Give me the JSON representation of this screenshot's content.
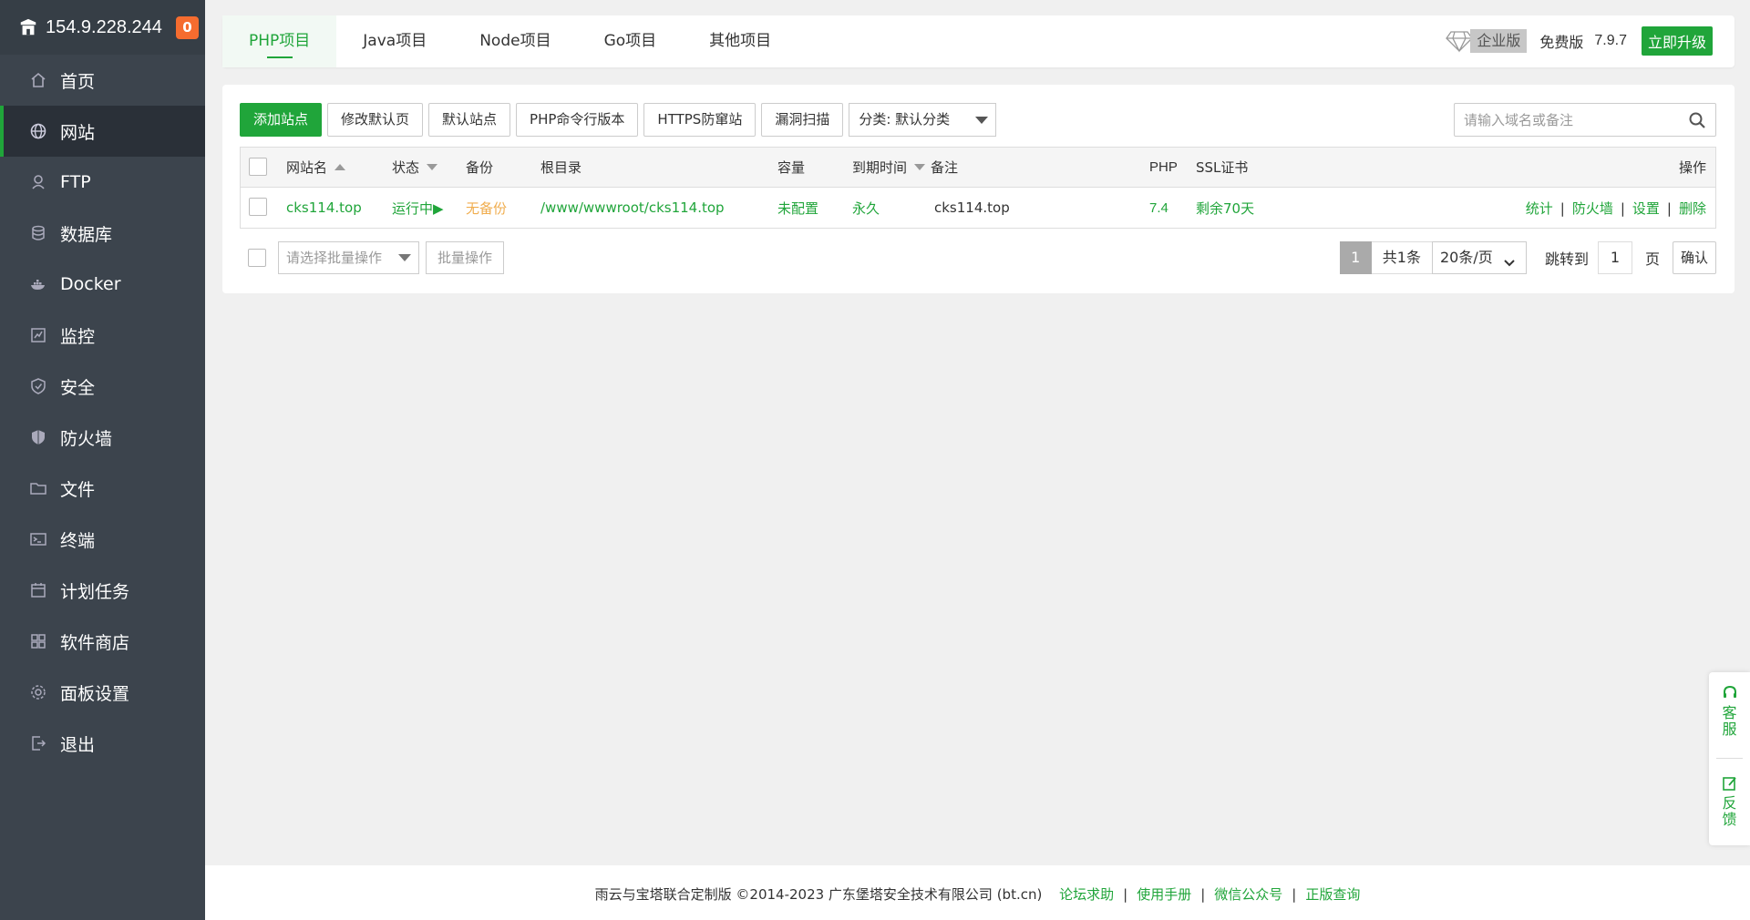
{
  "sidebar": {
    "ip": "154.9.228.244",
    "badge": "0",
    "items": [
      {
        "label": "首页",
        "icon": "home-icon"
      },
      {
        "label": "网站",
        "icon": "globe-icon"
      },
      {
        "label": "FTP",
        "icon": "ftp-icon"
      },
      {
        "label": "数据库",
        "icon": "database-icon"
      },
      {
        "label": "Docker",
        "icon": "docker-icon"
      },
      {
        "label": "监控",
        "icon": "monitor-icon"
      },
      {
        "label": "安全",
        "icon": "shield-check-icon"
      },
      {
        "label": "防火墙",
        "icon": "firewall-icon"
      },
      {
        "label": "文件",
        "icon": "folder-icon"
      },
      {
        "label": "终端",
        "icon": "terminal-icon"
      },
      {
        "label": "计划任务",
        "icon": "calendar-icon"
      },
      {
        "label": "软件商店",
        "icon": "apps-icon"
      },
      {
        "label": "面板设置",
        "icon": "gear-icon"
      },
      {
        "label": "退出",
        "icon": "logout-icon"
      }
    ]
  },
  "tabs": [
    "PHP项目",
    "Java项目",
    "Node项目",
    "Go项目",
    "其他项目"
  ],
  "version": {
    "enterprise": "企业版",
    "free": "免费版",
    "number": "7.9.7",
    "upgrade": "立即升级"
  },
  "toolbar": {
    "add_site": "添加站点",
    "modify_default": "修改默认页",
    "default_site": "默认站点",
    "php_cli": "PHP命令行版本",
    "https_guard": "HTTPS防窜站",
    "vuln_scan": "漏洞扫描",
    "category": "分类: 默认分类",
    "search_placeholder": "请输入域名或备注"
  },
  "table": {
    "headers": {
      "name": "网站名",
      "status": "状态",
      "backup": "备份",
      "root": "根目录",
      "capacity": "容量",
      "expire": "到期时间",
      "remark": "备注",
      "php": "PHP",
      "ssl": "SSL证书",
      "actions": "操作"
    },
    "rows": [
      {
        "name": "cks114.top",
        "status": "运行中▶",
        "backup": "无备份",
        "root": "/www/wwwroot/cks114.top",
        "capacity": "未配置",
        "expire": "永久",
        "remark": "cks114.top",
        "php": "7.4",
        "ssl": "剩余70天",
        "actions": [
          "统计",
          "防火墙",
          "设置",
          "删除"
        ]
      }
    ]
  },
  "batch": {
    "select_placeholder": "请选择批量操作",
    "button": "批量操作"
  },
  "pager": {
    "current": "1",
    "total": "共1条",
    "page_size": "20条/页",
    "jump_label": "跳转到",
    "jump_value": "1",
    "unit": "页",
    "confirm": "确认"
  },
  "footer": {
    "copyright": "雨云与宝塔联合定制版 ©2014-2023 广东堡塔安全技术有限公司 (bt.cn)",
    "links": [
      "论坛求助",
      "使用手册",
      "微信公众号",
      "正版查询"
    ]
  },
  "float": {
    "service": "客\n服",
    "feedback": "反\n馈"
  },
  "colors": {
    "accent": "#20a53a",
    "sidebar": "#3c444d",
    "badge": "#f56c2f",
    "warning": "#f0ad4e"
  }
}
